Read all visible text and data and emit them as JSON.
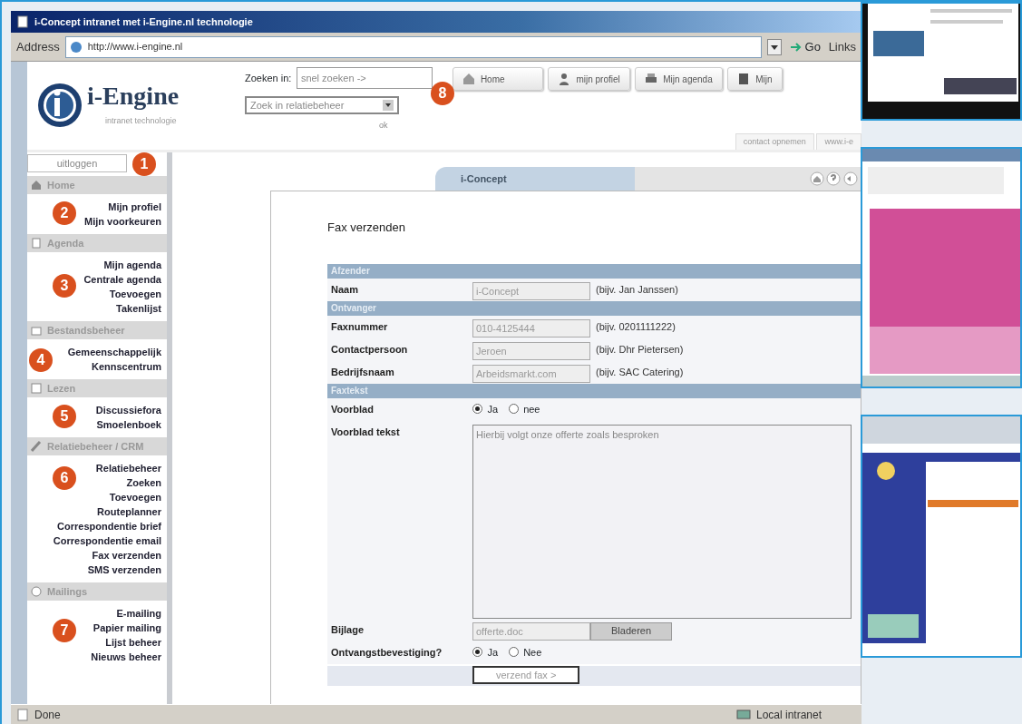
{
  "window": {
    "title": "i-Concept intranet met i-Engine.nl technologie"
  },
  "address_bar": {
    "label": "Address",
    "url": "http://www.i-engine.nl",
    "go": "Go",
    "links": "Links"
  },
  "header": {
    "logo_name": "i-Engine",
    "logo_tagline": "intranet technologie",
    "search_label": "Zoeken in:",
    "search_select": "snel zoeken ->",
    "search_scope": "Zoek in relatiebeheer",
    "search_ok": "ok",
    "callout": "8",
    "buttons": [
      {
        "label": "Home"
      },
      {
        "label": "mijn profiel"
      },
      {
        "label": "Mijn agenda"
      },
      {
        "label": "Mijn"
      }
    ],
    "tabs": [
      {
        "label": "contact opnemen"
      },
      {
        "label": "www.i-e"
      }
    ]
  },
  "sidebar": {
    "logout": "uitloggen",
    "logout_callout": "1",
    "sections": [
      {
        "title": "Home",
        "callout": "2",
        "items": [
          "Mijn profiel",
          "Mijn voorkeuren"
        ]
      },
      {
        "title": "Agenda",
        "callout": "3",
        "items": [
          "Mijn agenda",
          "Centrale agenda",
          "Toevoegen",
          "Takenlijst"
        ]
      },
      {
        "title": "Bestandsbeheer",
        "callout": "4",
        "items": [
          "Gemeenschappelijk",
          "Kennscentrum"
        ]
      },
      {
        "title": "Lezen",
        "callout": "5",
        "items": [
          "Discussiefora",
          "Smoelenboek"
        ]
      },
      {
        "title": "Relatiebeheer / CRM",
        "callout": "6",
        "items": [
          "Relatiebeheer",
          "Zoeken",
          "Toevoegen",
          "Routeplanner",
          "Correspondentie brief",
          "Correspondentie email",
          "Fax verzenden",
          "SMS verzenden"
        ]
      },
      {
        "title": "Mailings",
        "callout": "7",
        "items": [
          "E-mailing",
          "Papier mailing",
          "Lijst beheer",
          "Nieuws beheer"
        ]
      }
    ]
  },
  "content": {
    "tab": "i-Concept",
    "heading": "Fax verzenden",
    "groups": [
      {
        "title": "Afzender",
        "rows": [
          {
            "kind": "text",
            "label": "Naam",
            "value": "i-Concept",
            "hint": "(bijv. Jan Janssen)"
          }
        ]
      },
      {
        "title": "Ontvanger",
        "rows": [
          {
            "kind": "text",
            "label": "Faxnummer",
            "value": "010-4125444",
            "hint": "(bijv. 0201111222)"
          },
          {
            "kind": "text",
            "label": "Contactpersoon",
            "value": "Jeroen",
            "hint": "(bijv. Dhr Pietersen)"
          },
          {
            "kind": "text",
            "label": "Bedrijfsnaam",
            "value": "Arbeidsmarkt.com",
            "hint": "(bijv. SAC Catering)"
          }
        ]
      },
      {
        "title": "Faxtekst",
        "rows": [
          {
            "kind": "radio",
            "label": "Voorblad",
            "options": [
              {
                "label": "Ja",
                "selected": true
              },
              {
                "label": "nee",
                "selected": false
              }
            ]
          },
          {
            "kind": "textarea",
            "label": "Voorblad tekst",
            "value": "Hierbij volgt onze offerte zoals besproken"
          },
          {
            "kind": "file",
            "label": "Bijlage",
            "value": "offerte.doc",
            "button": "Bladeren"
          },
          {
            "kind": "radio",
            "label": "Ontvangstbevestiging?",
            "options": [
              {
                "label": "Ja",
                "selected": true
              },
              {
                "label": "Nee",
                "selected": false
              }
            ]
          }
        ]
      }
    ],
    "submit": "verzend fax >"
  },
  "status_bar": {
    "text": "Done",
    "zone": "Local intranet"
  }
}
